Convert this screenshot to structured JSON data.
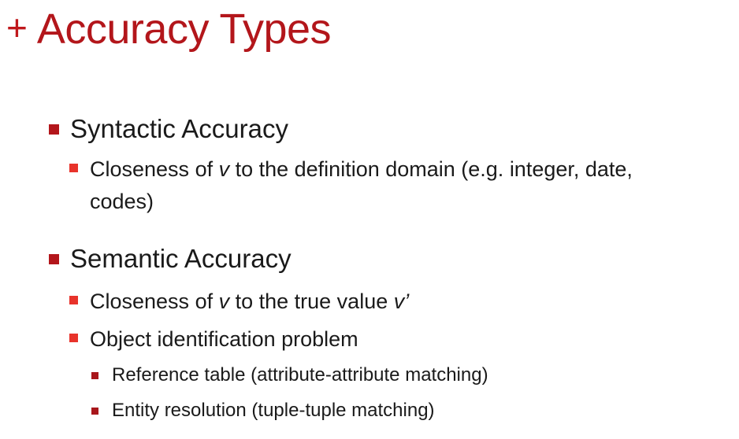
{
  "slide": {
    "title_plus": "+",
    "title": "Accuracy Types",
    "sections": [
      {
        "heading": "Syntactic Accuracy",
        "points": [
          {
            "line1_before": "Closeness of ",
            "line1_var": "v",
            "line1_after": " to the definition domain (e.g. integer, date,",
            "line2": "codes)"
          }
        ]
      },
      {
        "heading": "Semantic Accuracy",
        "points": [
          {
            "before": "Closeness of ",
            "var1": "v",
            "middle": " to the true value ",
            "var2": "v’"
          },
          {
            "text": "Object identification problem",
            "subpoints": [
              "Reference table (attribute-attribute matching)",
              "Entity resolution (tuple-tuple matching)"
            ]
          }
        ]
      }
    ]
  },
  "colors": {
    "title": "#b3161b",
    "level1_bullet": "#b3161b",
    "level2_bullet": "#e8332b",
    "level3_bullet": "#a8161b",
    "body_text": "#1a1a1a"
  }
}
